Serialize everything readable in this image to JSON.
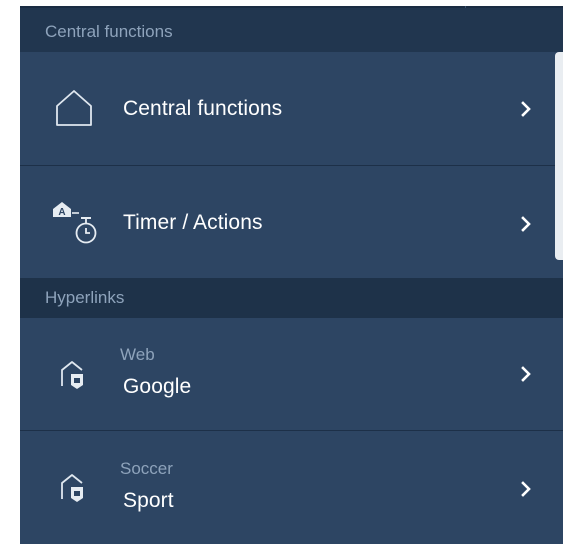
{
  "sections": [
    {
      "header": "Central functions",
      "items": [
        {
          "label": "Central functions",
          "icon": "home-outline-icon"
        },
        {
          "label": "Timer / Actions",
          "icon": "timer-actions-icon"
        }
      ]
    },
    {
      "header": "Hyperlinks",
      "items": [
        {
          "sublabel": "Web",
          "label": "Google",
          "icon": "hyperlink-house-icon"
        },
        {
          "sublabel": "Soccer",
          "label": "Sport",
          "icon": "hyperlink-house-icon"
        }
      ]
    }
  ],
  "colors": {
    "background": "#21364f",
    "row": "#2d4563",
    "header_text": "#8ea3bb",
    "label_text": "#ffffff"
  }
}
